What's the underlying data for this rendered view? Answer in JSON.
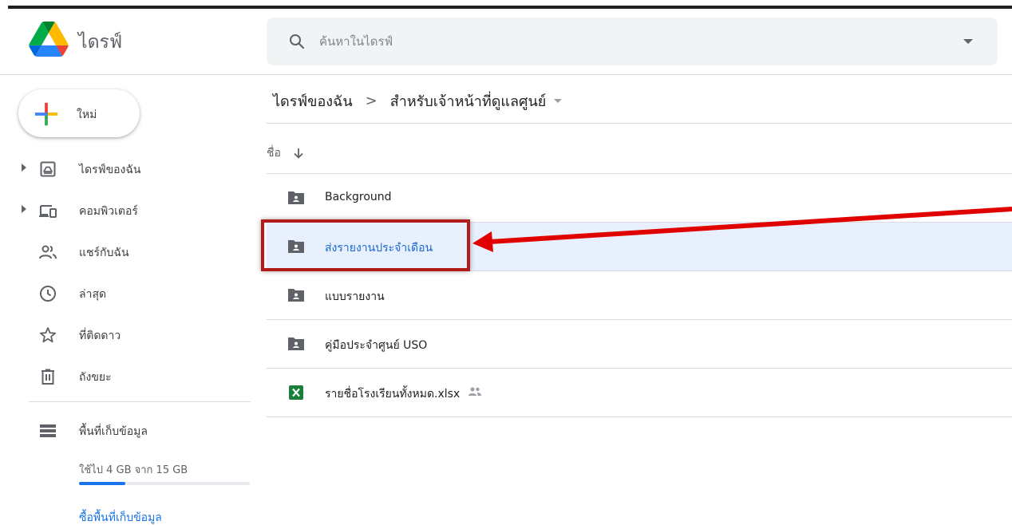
{
  "app": {
    "title": "ไดรฟ์"
  },
  "search": {
    "placeholder": "ค้นหาในไดรฟ์"
  },
  "sidebar": {
    "new_label": "ใหม่",
    "items": [
      {
        "label": "ไดรฟ์ของฉัน",
        "icon": "my-drive-icon"
      },
      {
        "label": "คอมพิวเตอร์",
        "icon": "computer-icon"
      },
      {
        "label": "แชร์กับฉัน",
        "icon": "people-icon"
      },
      {
        "label": "ล่าสุด",
        "icon": "clock-icon"
      },
      {
        "label": "ที่ติดดาว",
        "icon": "star-icon"
      },
      {
        "label": "ถังขยะ",
        "icon": "trash-icon"
      }
    ],
    "storage": {
      "label": "พื้นที่เก็บข้อมูล",
      "usage_text": "ใช้ไป 4 GB จาก 15 GB",
      "used_fraction": 0.27,
      "buy_label": "ซื้อพื้นที่เก็บข้อมูล"
    }
  },
  "breadcrumb": {
    "root": "ไดรฟ์ของฉัน",
    "separator": ">",
    "current": "สำหรับเจ้าหน้าที่ดูแลศูนย์"
  },
  "list": {
    "name_header": "ชื่อ",
    "sort_icon": "arrow-down-icon",
    "files": [
      {
        "name": "Background",
        "type": "shared-folder",
        "selected": false
      },
      {
        "name": "ส่งรายงานประจำเดือน",
        "type": "shared-folder",
        "selected": true
      },
      {
        "name": "แบบรายงาน",
        "type": "shared-folder",
        "selected": false
      },
      {
        "name": "คู่มือประจำศูนย์ USO",
        "type": "shared-folder",
        "selected": false
      },
      {
        "name": "รายชื่อโรงเรียนทั้งหมด.xlsx",
        "type": "excel",
        "selected": false,
        "shared": true
      }
    ]
  },
  "annotation": {
    "highlight_color": "#b31b1b",
    "arrow_color": "#e00000"
  },
  "colors": {
    "accent": "#1a73e8",
    "selected_row": "#e8f0fe",
    "excel_green": "#188038"
  }
}
